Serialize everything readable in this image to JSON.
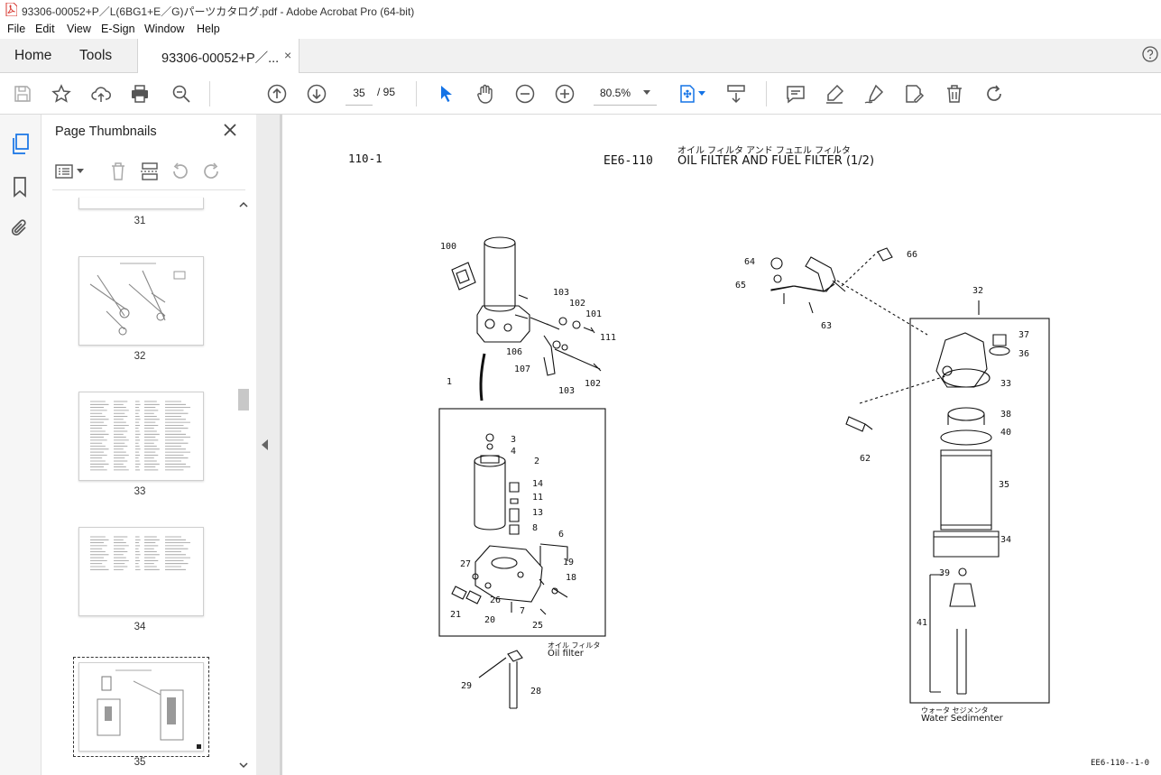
{
  "window": {
    "title": "93306-00052+P／L(6BG1+E／G)パーツカタログ.pdf - Adobe Acrobat Pro (64-bit)"
  },
  "menu": [
    "File",
    "Edit",
    "View",
    "E-Sign",
    "Window",
    "Help"
  ],
  "tabs": {
    "home": "Home",
    "tools": "Tools",
    "document": "93306-00052+P／...",
    "close": "×"
  },
  "toolbar": {
    "current_page": "35",
    "page_total": "/ 95",
    "zoom": "80.5%"
  },
  "panel": {
    "title": "Page Thumbnails",
    "thumbnails": [
      {
        "page": "31"
      },
      {
        "page": "32"
      },
      {
        "page": "33"
      },
      {
        "page": "34"
      },
      {
        "page": "35"
      }
    ]
  },
  "document": {
    "page_code": "110-1",
    "section_code": "EE6-110",
    "title_jp": "オイル フィルタ アンド フュエル フィルタ",
    "title_en": "OIL FILTER AND FUEL FILTER (1/2)",
    "oil_filter_jp": "オイル フィルタ",
    "oil_filter_en": "Oil filter",
    "water_sed_jp": "ウォータ セジメンタ",
    "water_sed_en": "Water Sedimenter",
    "footer_code": "EE6-110--1-0",
    "callouts_left": [
      "100",
      "103",
      "102",
      "101",
      "111",
      "106",
      "107",
      "103",
      "102",
      "1",
      "3",
      "4",
      "2",
      "14",
      "11",
      "13",
      "8",
      "6",
      "19",
      "18",
      "27",
      "26",
      "21",
      "20",
      "7",
      "25",
      "29",
      "28"
    ],
    "callouts_right": [
      "64",
      "65",
      "66",
      "63",
      "32",
      "37",
      "36",
      "33",
      "38",
      "40",
      "62",
      "35",
      "34",
      "39",
      "41"
    ]
  },
  "colors": {
    "accent": "#1473e6",
    "pdf_red": "#d7372f",
    "icon": "#555555"
  }
}
